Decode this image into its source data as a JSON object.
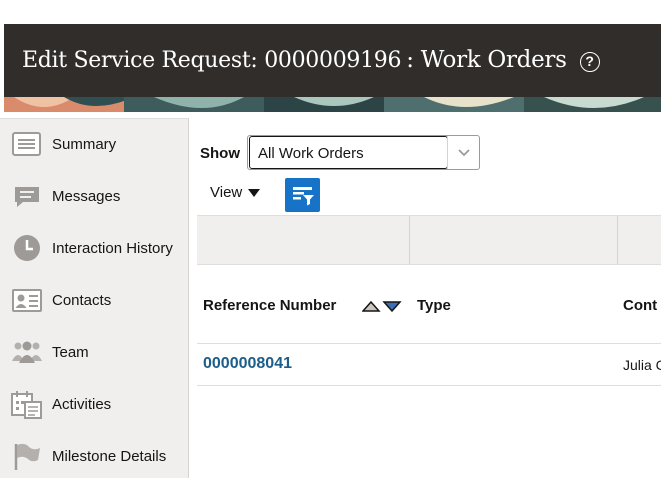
{
  "header": {
    "title": "Edit Service Request: 0000009196",
    "subtitle": ": Work Orders",
    "help_icon": "question-circle-icon"
  },
  "sidebar": {
    "items": [
      {
        "label": "Summary",
        "icon": "summary-list-icon"
      },
      {
        "label": "Messages",
        "icon": "message-bubble-icon"
      },
      {
        "label": "Interaction History",
        "icon": "clock-icon"
      },
      {
        "label": "Contacts",
        "icon": "contact-card-icon"
      },
      {
        "label": "Team",
        "icon": "team-people-icon"
      },
      {
        "label": "Activities",
        "icon": "calendar-icon"
      },
      {
        "label": "Milestone Details",
        "icon": "flag-icon"
      }
    ]
  },
  "filter": {
    "show_label": "Show",
    "show_value": "All Work Orders",
    "view_label": "View"
  },
  "table": {
    "columns": [
      "Reference Number",
      "Type",
      "Cont"
    ],
    "rows": [
      {
        "reference_number": "0000008041",
        "type": "",
        "contact": "Julia C"
      }
    ]
  },
  "colors": {
    "header_bg": "#312d2a",
    "sidebar_bg": "#f1efed",
    "link": "#1c5d8a",
    "accent_button": "#1673c7"
  }
}
